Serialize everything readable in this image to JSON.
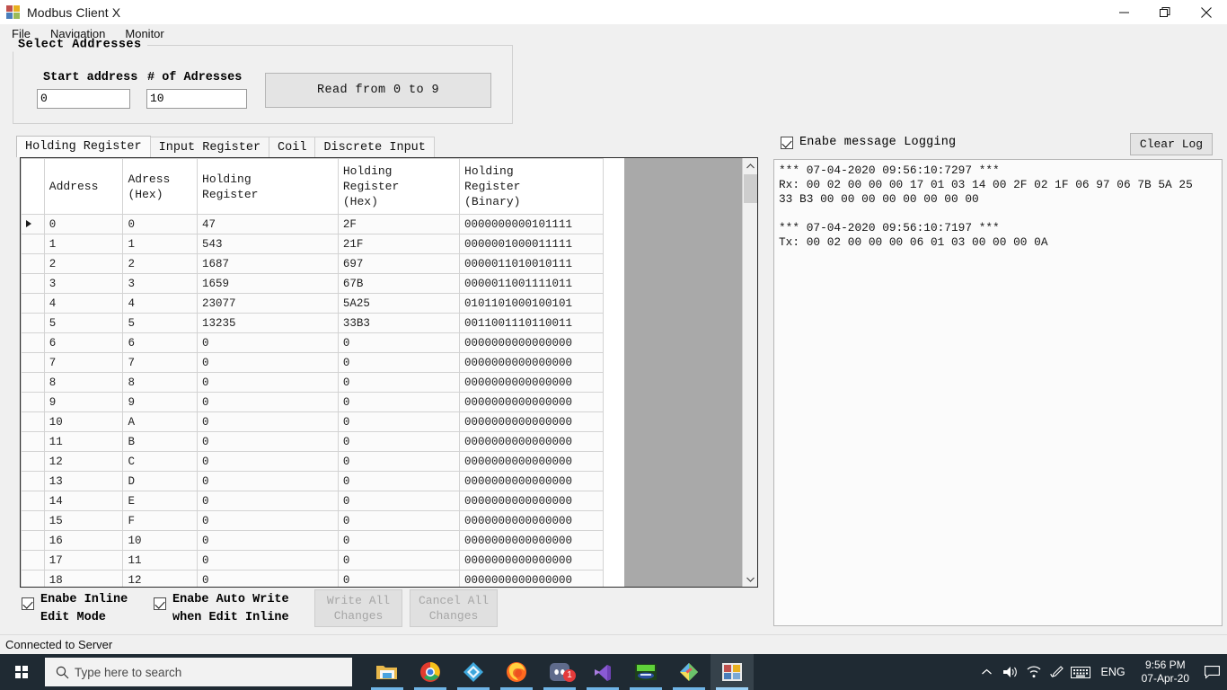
{
  "window": {
    "title": "Modbus Client X",
    "icon": "app-icon",
    "controls": {
      "minimize": "minimize-icon",
      "maximize": "restore-icon",
      "close": "close-icon"
    }
  },
  "menu": {
    "items": [
      {
        "label": "File"
      },
      {
        "label": "Navigation"
      },
      {
        "label": "Monitor"
      }
    ]
  },
  "select_addresses": {
    "legend": "Select  Addresses",
    "start_address_label": "Start address",
    "start_address_value": "0",
    "num_addresses_label": "# of Adresses",
    "num_addresses_value": "10",
    "read_button_label": "Read from 0 to 9"
  },
  "tabs": [
    {
      "label": "Holding Register",
      "active": true
    },
    {
      "label": "Input Register",
      "active": false
    },
    {
      "label": "Coil",
      "active": false
    },
    {
      "label": "Discrete Input",
      "active": false
    }
  ],
  "grid": {
    "columns": [
      "Address",
      "Adress\n(Hex)",
      "Holding\nRegister",
      "Holding\nRegister\n(Hex)",
      "Holding\nRegister\n(Binary)"
    ],
    "selected_row": 0,
    "selected_column": 0,
    "rows": [
      {
        "address": "0",
        "address_hex": "0",
        "value": "47",
        "value_hex": "2F",
        "value_bin": "0000000000101111"
      },
      {
        "address": "1",
        "address_hex": "1",
        "value": "543",
        "value_hex": "21F",
        "value_bin": "0000001000011111"
      },
      {
        "address": "2",
        "address_hex": "2",
        "value": "1687",
        "value_hex": "697",
        "value_bin": "0000011010010111"
      },
      {
        "address": "3",
        "address_hex": "3",
        "value": "1659",
        "value_hex": "67B",
        "value_bin": "0000011001111011"
      },
      {
        "address": "4",
        "address_hex": "4",
        "value": "23077",
        "value_hex": "5A25",
        "value_bin": "0101101000100101"
      },
      {
        "address": "5",
        "address_hex": "5",
        "value": "13235",
        "value_hex": "33B3",
        "value_bin": "0011001110110011"
      },
      {
        "address": "6",
        "address_hex": "6",
        "value": "0",
        "value_hex": "0",
        "value_bin": "0000000000000000"
      },
      {
        "address": "7",
        "address_hex": "7",
        "value": "0",
        "value_hex": "0",
        "value_bin": "0000000000000000"
      },
      {
        "address": "8",
        "address_hex": "8",
        "value": "0",
        "value_hex": "0",
        "value_bin": "0000000000000000"
      },
      {
        "address": "9",
        "address_hex": "9",
        "value": "0",
        "value_hex": "0",
        "value_bin": "0000000000000000"
      },
      {
        "address": "10",
        "address_hex": "A",
        "value": "0",
        "value_hex": "0",
        "value_bin": "0000000000000000"
      },
      {
        "address": "11",
        "address_hex": "B",
        "value": "0",
        "value_hex": "0",
        "value_bin": "0000000000000000"
      },
      {
        "address": "12",
        "address_hex": "C",
        "value": "0",
        "value_hex": "0",
        "value_bin": "0000000000000000"
      },
      {
        "address": "13",
        "address_hex": "D",
        "value": "0",
        "value_hex": "0",
        "value_bin": "0000000000000000"
      },
      {
        "address": "14",
        "address_hex": "E",
        "value": "0",
        "value_hex": "0",
        "value_bin": "0000000000000000"
      },
      {
        "address": "15",
        "address_hex": "F",
        "value": "0",
        "value_hex": "0",
        "value_bin": "0000000000000000"
      },
      {
        "address": "16",
        "address_hex": "10",
        "value": "0",
        "value_hex": "0",
        "value_bin": "0000000000000000"
      },
      {
        "address": "17",
        "address_hex": "11",
        "value": "0",
        "value_hex": "0",
        "value_bin": "0000000000000000"
      },
      {
        "address": "18",
        "address_hex": "12",
        "value": "0",
        "value_hex": "0",
        "value_bin": "0000000000000000"
      }
    ]
  },
  "bottom_controls": {
    "inline_edit_label": "Enabe Inline\nEdit Mode",
    "inline_edit_checked": true,
    "auto_write_label": "Enabe Auto Write\nwhen Edit Inline",
    "auto_write_checked": true,
    "write_all_label": "Write All\nChanges",
    "write_all_enabled": false,
    "cancel_all_label": "Cancel All\nChanges",
    "cancel_all_enabled": false
  },
  "log_panel": {
    "enable_logging_label": "Enabe message Logging",
    "enable_logging_checked": true,
    "clear_log_label": "Clear Log",
    "content": "*** 07-04-2020 09:56:10:7297 ***\nRx: 00 02 00 00 00 17 01 03 14 00 2F 02 1F 06 97 06 7B 5A 25\n33 B3 00 00 00 00 00 00 00 00\n\n*** 07-04-2020 09:56:10:7197 ***\nTx: 00 02 00 00 00 06 01 03 00 00 00 0A"
  },
  "status_bar": {
    "text": "Connected to Server"
  },
  "taskbar": {
    "start_label": "start-button",
    "search_placeholder": "Type here to search",
    "apps": [
      {
        "name": "file-explorer",
        "active": false
      },
      {
        "name": "google-chrome",
        "active": false
      },
      {
        "name": "kodi",
        "active": false
      },
      {
        "name": "firefox",
        "active": false
      },
      {
        "name": "discord",
        "active": false,
        "badge": "1"
      },
      {
        "name": "visual-studio-code",
        "active": false
      },
      {
        "name": "ethernet-app",
        "active": false
      },
      {
        "name": "paint-app",
        "active": false
      },
      {
        "name": "modbus-client-x",
        "active": true
      }
    ],
    "tray": {
      "chevron": "chevron-up-icon",
      "volume": "volume-icon",
      "network": "wifi-icon",
      "pen": "pen-icon",
      "keyboard": "touch-keyboard-icon",
      "language": "ENG",
      "time": "9:56 PM",
      "date": "07-Apr-20",
      "action_center": "action-center-icon"
    }
  },
  "colors": {
    "selection": "#0078d7",
    "window_bg": "#f0f0f0",
    "grid_filler": "#a9a9a9",
    "taskbar": "#1f2a33"
  }
}
